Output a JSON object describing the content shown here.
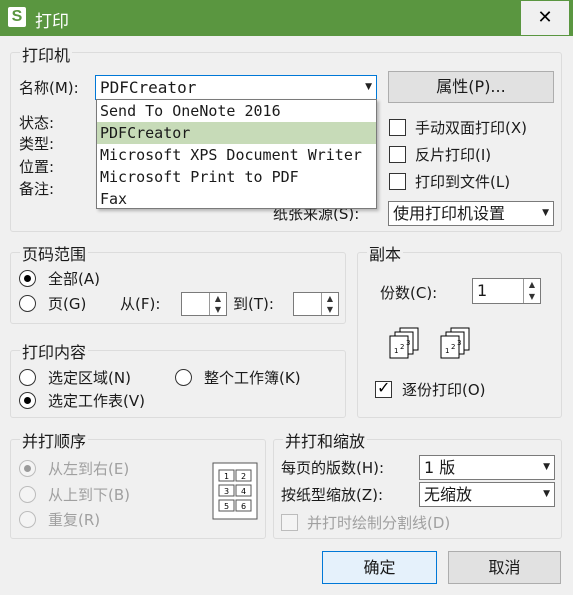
{
  "window": {
    "title": "打印",
    "app_icon_letter": "S",
    "close_symbol": "✕"
  },
  "printer": {
    "legend": "打印机",
    "name_label": "名称(M):",
    "selected": "PDFCreator",
    "properties_button": "属性(P)...",
    "status_label": "状态:",
    "type_label": "类型:",
    "location_label": "位置:",
    "comment_label": "备注:",
    "options": [
      "Send To OneNote 2016",
      "PDFCreator",
      "Microsoft XPS Document Writer",
      "Microsoft Print to PDF",
      "Fax"
    ],
    "duplex_label": "手动双面打印(X)",
    "reverse_label": "反片打印(I)",
    "to_file_label": "打印到文件(L)",
    "paper_source_label": "纸张来源(S):",
    "paper_source_value": "使用打印机设置"
  },
  "page_range": {
    "legend": "页码范围",
    "all_label": "全部(A)",
    "pages_label": "页(G)",
    "from_label": "从(F):",
    "to_label": "到(T):",
    "from_value": "",
    "to_value": ""
  },
  "copies": {
    "legend": "副本",
    "count_label": "份数(C):",
    "count_value": "1",
    "collate_label": "逐份打印(O)",
    "collate_checked": true
  },
  "print_what": {
    "legend": "打印内容",
    "selection_label": "选定区域(N)",
    "workbook_label": "整个工作簿(K)",
    "sheet_label": "选定工作表(V)"
  },
  "order": {
    "legend": "并打顺序",
    "lr_label": "从左到右(E)",
    "tb_label": "从上到下(B)",
    "repeat_label": "重复(R)",
    "grid_numbers": [
      "1",
      "2",
      "3",
      "4",
      "5",
      "6"
    ]
  },
  "zoom": {
    "legend": "并打和缩放",
    "pages_per_sheet_label": "每页的版数(H):",
    "pages_per_sheet_value": "1 版",
    "scale_label": "按纸型缩放(Z):",
    "scale_value": "无缩放",
    "divider_label": "并打时绘制分割线(D)"
  },
  "buttons": {
    "ok": "确定",
    "cancel": "取消"
  }
}
